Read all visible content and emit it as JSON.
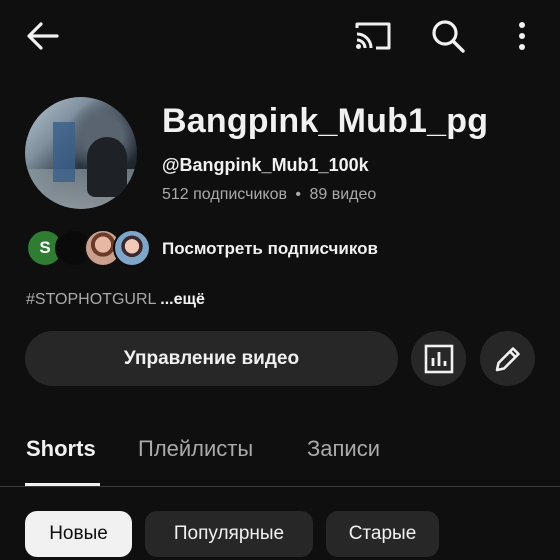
{
  "topbar": {
    "icons": [
      "back-arrow-icon",
      "cast-icon",
      "search-icon",
      "more-vert-icon"
    ]
  },
  "channel": {
    "name": "Bangpink_Mub1_pg",
    "handle": "@Bangpink_Mub1_100k",
    "subscribers": "512 подписчиков",
    "separator": "•",
    "videos": "89 видео",
    "subscriber_initial": "S",
    "view_subscribers_label": "Посмотреть подписчиков",
    "description": "#STOPHOTGURL",
    "more_label": "...ещё"
  },
  "actions": {
    "manage_videos_label": "Управление видео",
    "analytics_icon": "analytics-icon",
    "edit_icon": "edit-pencil-icon"
  },
  "tabs": [
    {
      "label": "Shorts",
      "active": true
    },
    {
      "label": "Плейлисты",
      "active": false
    },
    {
      "label": "Записи",
      "active": false
    }
  ],
  "chips": [
    {
      "label": "Новые",
      "selected": true
    },
    {
      "label": "Популярные",
      "selected": false
    },
    {
      "label": "Старые",
      "selected": false
    }
  ]
}
